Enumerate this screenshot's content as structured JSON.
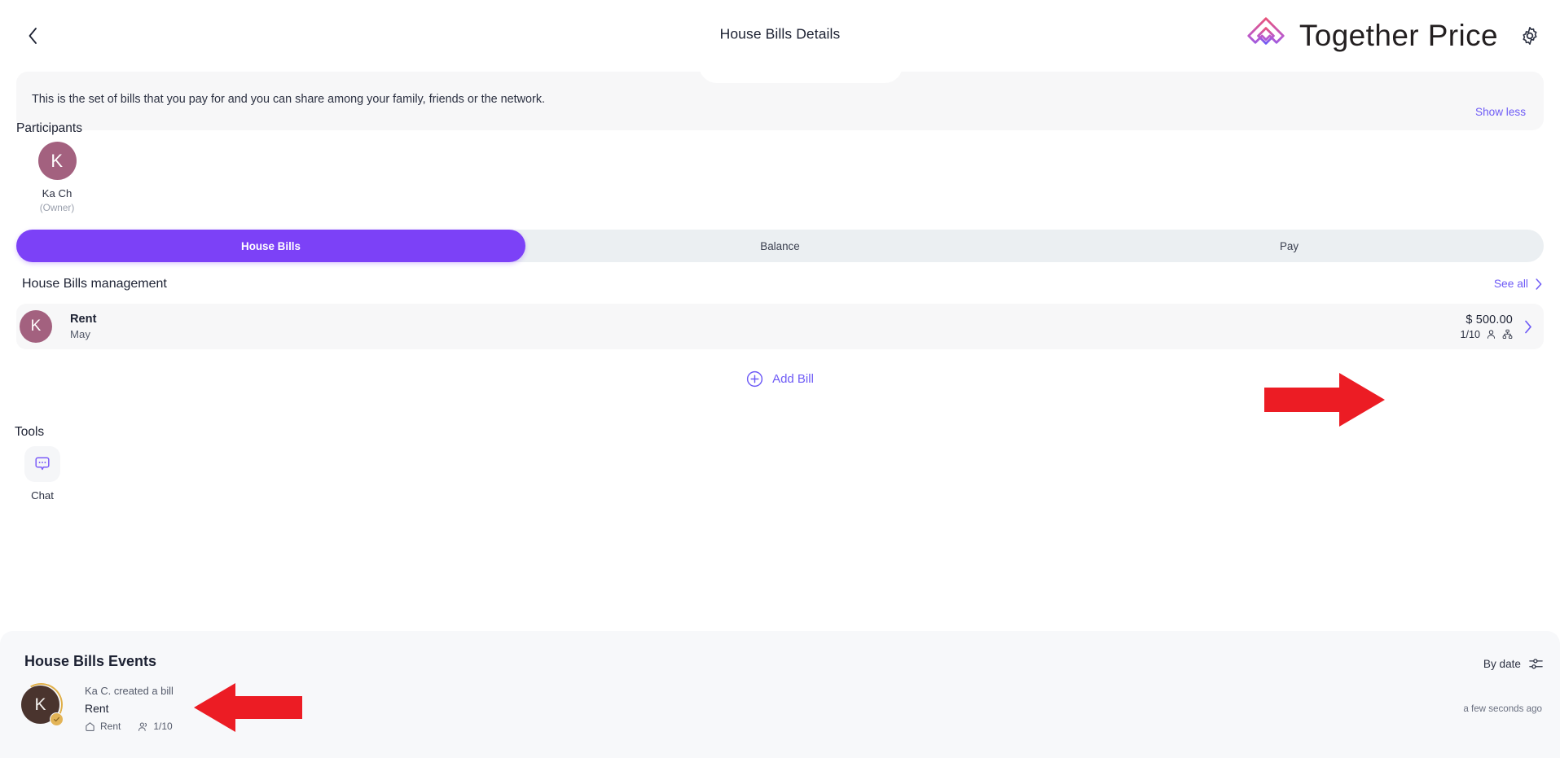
{
  "header": {
    "back_icon": "chevron-left-icon",
    "title": "House Bills Details",
    "brand_name": "Together Price",
    "brand_mark_icon": "together-price-logo-icon",
    "settings_icon": "gear-icon",
    "brand_gradient_start": "#e8547c",
    "brand_gradient_end": "#6e5bf6"
  },
  "banner": {
    "text": "This is the set of bills that you pay for and you can share among your family, friends or the network.",
    "toggle_label": "Show less",
    "background": "#f7f7f8",
    "link_color": "#6e5bf6"
  },
  "participants": {
    "title": "Participants",
    "items": [
      {
        "initial": "K",
        "name": "Ka Ch",
        "role": "(Owner)",
        "avatar_color": "#a3617f"
      }
    ]
  },
  "tabs": {
    "active_color": "#7c41f7",
    "inactive_background": "#ebeff2",
    "items": [
      {
        "label": "House Bills",
        "active": true
      },
      {
        "label": "Balance",
        "active": false
      },
      {
        "label": "Pay",
        "active": false
      }
    ]
  },
  "management": {
    "title": "House Bills management",
    "see_all_label": "See all",
    "see_all_icon": "chevron-right-icon",
    "bills": [
      {
        "initial": "K",
        "avatar_color": "#a3617f",
        "name": "Rent",
        "period": "May",
        "amount": "$ 500.00",
        "members": "1/10",
        "person_icon": "person-icon",
        "network-icon": "network-icon",
        "chevron_icon": "chevron-right-icon"
      }
    ],
    "add_bill_label": "Add Bill",
    "add_bill_icon": "plus-circle-icon"
  },
  "tools": {
    "title": "Tools",
    "items": [
      {
        "label": "Chat",
        "icon": "chat-bubble-icon"
      }
    ]
  },
  "events": {
    "title": "House Bills Events",
    "sort_label": "By date",
    "sort_icon": "filter-sliders-icon",
    "items": [
      {
        "initial": "K",
        "avatar_color": "#4a342e",
        "ring_color": "#e0b04a",
        "badge_icon": "verified-badge-icon",
        "action": "Ka C. created a bill",
        "title": "Rent",
        "tag_group_icon": "house-icon",
        "tag_group": "Rent",
        "tag_members_icon": "people-icon",
        "tag_members": "1/10",
        "time": "a few seconds ago"
      }
    ]
  },
  "annotations": {
    "arrow_color": "#ec1c24",
    "arrows": [
      {
        "name": "arrow-pointing-to-bill-amount",
        "direction": "right"
      },
      {
        "name": "arrow-pointing-to-event-entry",
        "direction": "left"
      }
    ]
  }
}
